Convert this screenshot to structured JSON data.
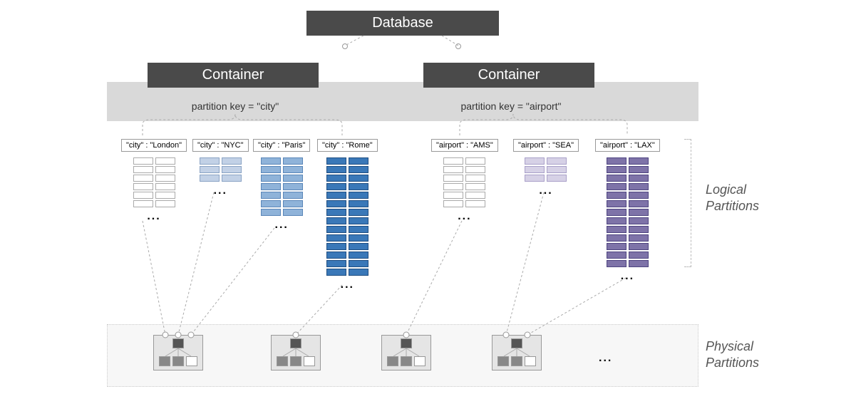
{
  "database": {
    "title": "Database"
  },
  "containers": [
    {
      "title": "Container",
      "partitionKey": "partition key = \"city\"",
      "partitions": [
        {
          "label": "\"city\" : \"London\"",
          "colorClass": "white",
          "rows": 6
        },
        {
          "label": "\"city\" : \"NYC\"",
          "colorClass": "lightblue",
          "rows": 3
        },
        {
          "label": "\"city\" : \"Paris\"",
          "colorClass": "midblue",
          "rows": 7
        },
        {
          "label": "\"city\" : \"Rome\"",
          "colorClass": "blue",
          "rows": 14
        }
      ]
    },
    {
      "title": "Container",
      "partitionKey": "partition key = \"airport\"",
      "partitions": [
        {
          "label": "\"airport\" : \"AMS\"",
          "colorClass": "white",
          "rows": 6
        },
        {
          "label": "\"airport\" : \"SEA\"",
          "colorClass": "lightpurple",
          "rows": 3
        },
        {
          "label": "\"airport\" : \"LAX\"",
          "colorClass": "purple",
          "rows": 13
        }
      ]
    }
  ],
  "labels": {
    "logical": "Logical Partitions",
    "physical": "Physical Partitions"
  },
  "dots": "..."
}
